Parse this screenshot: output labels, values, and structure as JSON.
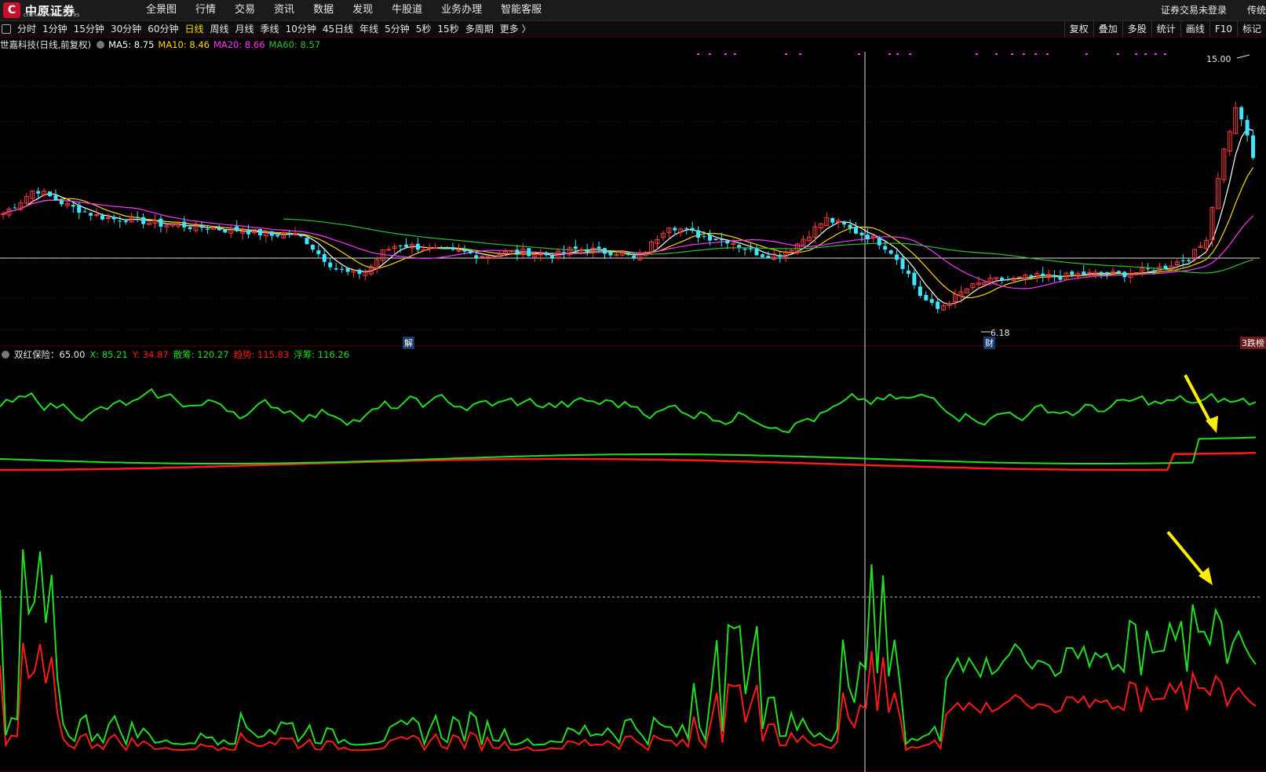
{
  "top_nav": {
    "logo_text": "中原证券",
    "logo_sub": "CENTRAL CHINA SECURITIES",
    "items": [
      "全景图",
      "行情",
      "交易",
      "资讯",
      "数据",
      "发现",
      "牛股道",
      "业务办理",
      "智能客服"
    ],
    "login_status": "证券交易未登录",
    "right_cut": "传统"
  },
  "period_bar": {
    "periods": [
      "分时",
      "1分钟",
      "15分钟",
      "30分钟",
      "60分钟",
      "日线",
      "周线",
      "月线",
      "季线",
      "10分钟",
      "45日线",
      "年线",
      "5分钟",
      "5秒",
      "15秒",
      "多周期",
      "更多 〉"
    ],
    "active": "日线",
    "tools": [
      "复权",
      "叠加",
      "多股",
      "统计",
      "画线",
      "F10",
      "标记"
    ]
  },
  "main_legend": {
    "title": "世嘉科技(日线,前复权)",
    "ma5": "MA5: 8.75",
    "ma10": "MA10: 8.46",
    "ma20": "MA20: 8.66",
    "ma60": "MA60: 8.57"
  },
  "indicator_legend": {
    "name": "双红保险：65.00",
    "x": "X: 85.21",
    "y": "Y: 34.87",
    "sanchou": "散筹: 120.27",
    "qushi": "趋势: 115.83",
    "fuchou": "浮筹: 116.26"
  },
  "annotations": {
    "high_price": "15.00",
    "low_price": "6.18",
    "marker_jie": "解",
    "marker_cai": "财",
    "marker_top": "3跌榜"
  },
  "colors": {
    "up": "#ff3b3b",
    "down": "#3ee6ff",
    "ma5": "#ffffff",
    "ma10": "#ffd700",
    "ma20": "#ff33ff",
    "ma60": "#2ec02e",
    "ind_green": "#22dd22",
    "ind_red": "#ff1a1a",
    "arrow": "#ffee00"
  },
  "chart_data": [
    {
      "type": "candlestick",
      "title": "世嘉科技(日线,前复权)",
      "y_annotations": {
        "max": 15.0,
        "min": 6.18
      },
      "series": [
        {
          "name": "MA5",
          "last": 8.75
        },
        {
          "name": "MA10",
          "last": 8.46
        },
        {
          "name": "MA20",
          "last": 8.66
        },
        {
          "name": "MA60",
          "last": 8.57
        }
      ],
      "close_path": [
        10.0,
        10.4,
        10.9,
        10.6,
        10.3,
        10.1,
        9.9,
        9.8,
        9.8,
        9.7,
        9.6,
        9.6,
        9.5,
        9.5,
        9.4,
        9.4,
        9.3,
        9.2,
        9.3,
        9.1,
        8.5,
        8.0,
        7.8,
        7.9,
        8.6,
        8.9,
        8.8,
        8.7,
        8.6,
        8.6,
        8.5,
        8.5,
        8.6,
        8.6,
        8.5,
        8.5,
        8.7,
        8.7,
        8.6,
        8.6,
        8.3,
        8.9,
        9.6,
        9.4,
        9.2,
        9.1,
        9.0,
        8.7,
        8.5,
        8.5,
        8.8,
        9.3,
        9.8,
        9.6,
        9.3,
        9.1,
        8.7,
        8.0,
        7.0,
        6.5,
        6.9,
        7.3,
        7.5,
        7.6,
        7.6,
        7.7,
        7.7,
        7.7,
        7.8,
        7.8,
        7.8,
        7.8,
        7.9,
        8.0,
        8.2,
        8.4,
        9.0,
        12.0,
        14.0,
        12.0
      ]
    },
    {
      "type": "line",
      "title": "双红保险",
      "series": [
        {
          "name": "散筹",
          "last": 120.27
        },
        {
          "name": "趋势",
          "last": 115.83
        },
        {
          "name": "浮筹",
          "last": 116.26
        }
      ]
    },
    {
      "type": "line",
      "series": [
        {
          "name": "X",
          "last": 85.21
        },
        {
          "name": "Y",
          "last": 34.87
        }
      ]
    }
  ]
}
